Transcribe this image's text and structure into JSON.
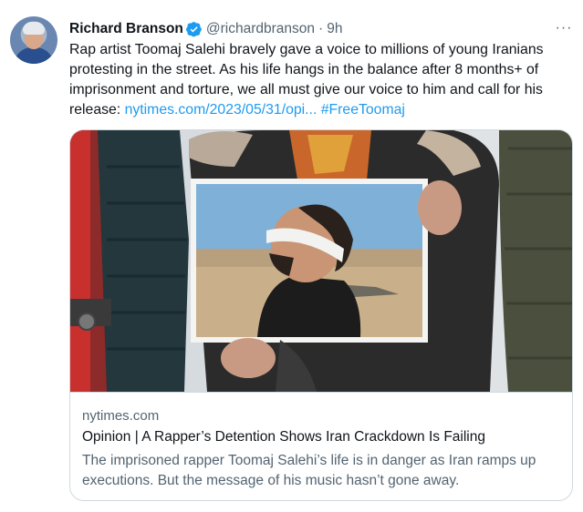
{
  "tweet": {
    "author_name": "Richard Branson",
    "handle": "@richardbranson",
    "separator": "·",
    "time": "9h",
    "more_label": "···",
    "body_text": "Rap artist Toomaj Salehi bravely gave a voice to millions of young Iranians protesting in the street. As his life hangs in the balance after 8 months+ of imprisonment and torture, we all must give our voice to him and call for his release: ",
    "link_text": "nytimes.com/2023/05/31/opi...",
    "hashtag": "#FreeToomaj"
  },
  "card": {
    "domain": "nytimes.com",
    "title": "Opinion | A Rapper’s Detention Shows Iran Crackdown Is Failing",
    "description": "The imprisoned rapper Toomaj Salehi’s life is in danger as Iran ramps up executions. But the message of his music hasn’t gone away."
  },
  "colors": {
    "link": "#1d9bf0",
    "verified_badge": "#1d9bf0",
    "secondary_text": "#536471",
    "border": "#cfd9de"
  },
  "icons": {
    "verified": "verified-badge-icon",
    "more": "more-options-icon"
  }
}
